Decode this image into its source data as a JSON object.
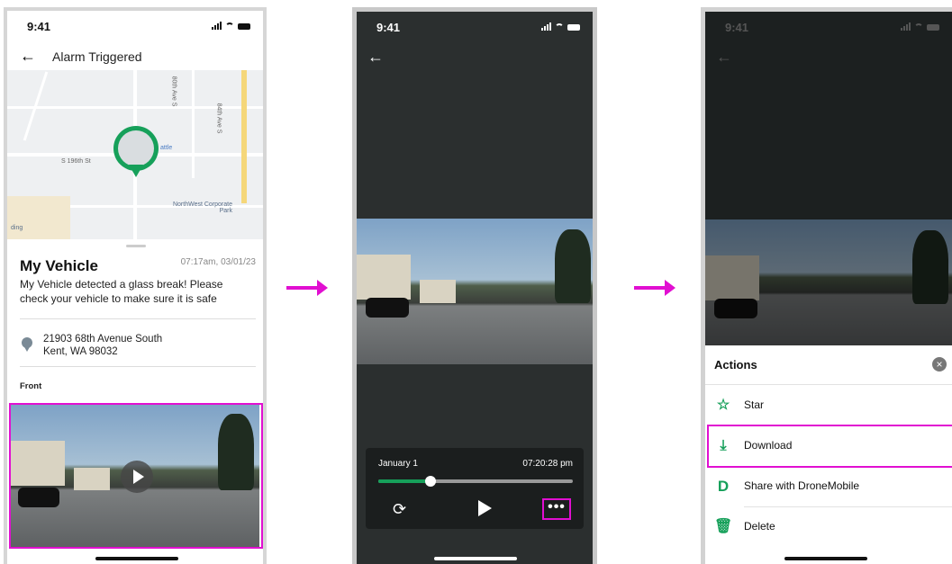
{
  "screen1": {
    "time": "9:41",
    "title": "Alarm Triggered",
    "map_labels": [
      "S 196th St",
      "80th Ave S",
      "84th Ave S",
      "NorthWest Corporate Park",
      "ding",
      "attle"
    ],
    "vehicle_name": "My Vehicle",
    "timestamp": "07:17am, 03/01/23",
    "message": "My Vehicle detected a glass break! Please check your vehicle to make sure it is safe",
    "address_line1": "21903 68th Avenue South",
    "address_line2": "Kent, WA 98032",
    "camera_label": "Front"
  },
  "screen2": {
    "time": "9:41",
    "date": "January 1",
    "clock": "07:20:28 pm",
    "progress": 0.27,
    "more_label": "•••"
  },
  "screen3": {
    "time": "9:41",
    "actions_title": "Actions",
    "actions": [
      {
        "label": "Star",
        "icon": "star-icon"
      },
      {
        "label": "Download",
        "icon": "download-icon"
      },
      {
        "label": "Share with DroneMobile",
        "icon": "dronemobile-icon"
      },
      {
        "label": "Delete",
        "icon": "trash-icon"
      }
    ]
  },
  "colors": {
    "accent": "#16a05a",
    "highlight": "#e10fd1"
  }
}
